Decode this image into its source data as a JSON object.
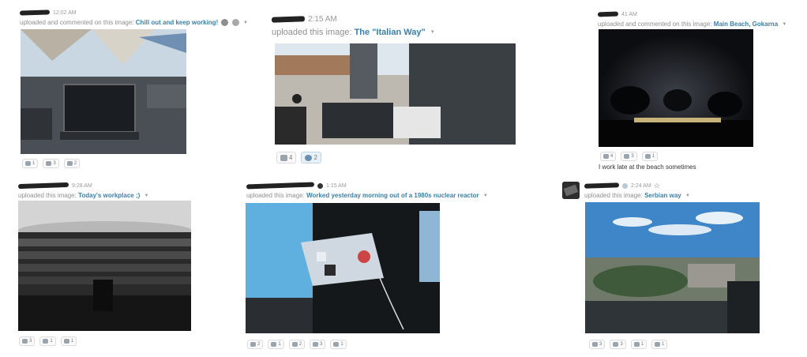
{
  "posts": [
    {
      "time": "12:02 AM",
      "action": "uploaded and commented on this image:",
      "title": "Chill out and keep working!",
      "image_subject": "laptop at a shaded outdoor lounge by the sea",
      "reactions": [
        {
          "icon": "reaction-icon",
          "count": "1"
        },
        {
          "icon": "reaction-icon",
          "count": "3"
        },
        {
          "icon": "reaction-icon",
          "count": "2"
        }
      ]
    },
    {
      "time": "2:15 AM",
      "action": "uploaded this image:",
      "title": "The \"Italian Way\"",
      "image_subject": "panoramic courtyard with dog and laptop on table",
      "reactions": [
        {
          "icon": "reaction-icon",
          "count": "4"
        },
        {
          "icon": "reaction-icon",
          "count": "2"
        }
      ]
    },
    {
      "time": "41 AM",
      "action": "uploaded and commented on this image:",
      "title": "Main Beach, Gokarna",
      "image_subject": "beach at night with lights and palm trees",
      "reactions": [
        {
          "icon": "reaction-icon",
          "count": "4"
        },
        {
          "icon": "reaction-icon",
          "count": "3"
        },
        {
          "icon": "reaction-icon",
          "count": "1"
        }
      ],
      "comment": "I work late at the beach sometimes"
    },
    {
      "time": "9:28 AM",
      "action": "uploaded this image:",
      "title": "Today's workplace ;)",
      "image_subject": "round library with tall bookshelves",
      "reactions": [
        {
          "icon": "reaction-icon",
          "count": "3"
        },
        {
          "icon": "reaction-icon",
          "count": "1"
        },
        {
          "icon": "reaction-icon",
          "count": "1"
        }
      ]
    },
    {
      "time": "1:15 AM",
      "action": "uploaded this image:",
      "title": "Worked yesterday morning out of a 1980s nuclear reactor",
      "image_subject": "laptop with stickers in a dark room with blue sky outside",
      "reactions": [
        {
          "icon": "reaction-icon",
          "count": "2"
        },
        {
          "icon": "reaction-icon",
          "count": "1"
        },
        {
          "icon": "reaction-icon",
          "count": "2"
        },
        {
          "icon": "reaction-icon",
          "count": "3"
        },
        {
          "icon": "reaction-icon",
          "count": "1"
        }
      ]
    },
    {
      "time": "2:24 AM",
      "action": "uploaded this image:",
      "title": "Serbian way",
      "image_subject": "city skyline view from a high window",
      "reactions": [
        {
          "icon": "reaction-icon",
          "count": "3"
        },
        {
          "icon": "reaction-icon",
          "count": "3"
        },
        {
          "icon": "reaction-icon",
          "count": "1"
        },
        {
          "icon": "reaction-icon",
          "count": "1"
        }
      ]
    }
  ],
  "colors": {
    "link": "#3b7fa8",
    "meta": "#8f8f8f",
    "reaction_border": "#dcdcdc"
  }
}
